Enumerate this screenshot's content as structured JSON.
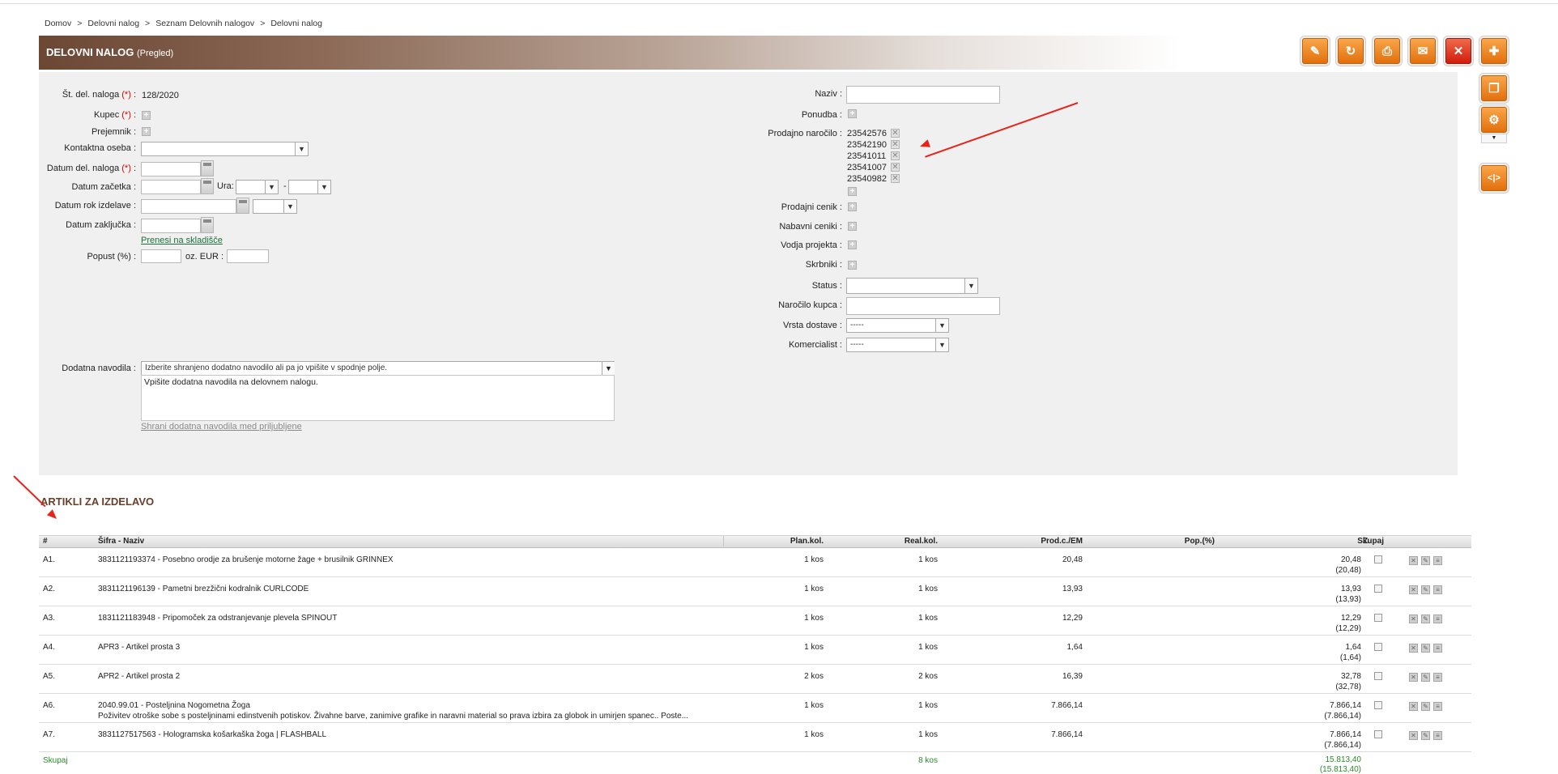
{
  "breadcrumb": [
    "Domov",
    "Delovni nalog",
    "Seznam Delovnih nalogov",
    "Delovni nalog"
  ],
  "breadcrumb_sep": ">",
  "header": {
    "title": "DELOVNI NALOG",
    "subtitle": "(Pregled)"
  },
  "toolbar": {
    "edit_icon": "pencil-icon",
    "refresh_icon": "refresh-icon",
    "print_icon": "printer-icon",
    "email_icon": "envelope-icon",
    "delete_icon": "close-icon",
    "add_icon": "plus-icon",
    "copy_icon": "copy-icon",
    "settings_icon": "gear-icon",
    "split_icon": "split-icon",
    "accent": "#f08a1c",
    "danger": "#d21c0b"
  },
  "form_left": {
    "st_label": "Št. del. naloga",
    "st_value": "128/2020",
    "kupec_label": "Kupec",
    "prejemnik_label": "Prejemnik",
    "kontakt_label": "Kontaktna oseba",
    "datum_del_label": "Datum del. naloga",
    "datum_zacetka_label": "Datum začetka",
    "ura_label": "Ura:",
    "dash": "-",
    "datum_rok_label": "Datum rok izdelave",
    "datum_zakljucka_label": "Datum zaključka",
    "prenesi_link": "Prenesi na skladišče",
    "popust_label": "Popust (%)",
    "oz_eur_label": "oz. EUR",
    "required_mark": "(*)",
    "colon": ":"
  },
  "form_right": {
    "naziv_label": "Naziv",
    "ponudba_label": "Ponudba",
    "prodajno_label": "Prodajno naročilo",
    "prodajna_narocila": [
      "23542576",
      "23542190",
      "23541011",
      "23541007",
      "23540982"
    ],
    "prodajni_cenik_label": "Prodajni cenik",
    "nabavni_ceniki_label": "Nabavni ceniki",
    "vodja_label": "Vodja projekta",
    "skrbniki_label": "Skrbniki",
    "status_label": "Status",
    "narocilo_kupca_label": "Naročilo kupca",
    "vrsta_dostave_label": "Vrsta dostave",
    "vrsta_dostave_value": "-----",
    "komercialist_label": "Komercialist",
    "komercialist_value": "-----"
  },
  "navodila": {
    "label": "Dodatna navodila",
    "select_placeholder": "Izberite shranjeno dodatno navodilo ali pa jo vpišite v spodnje polje.",
    "text": "Vpišite dodatna navodila na delovnem nalogu.",
    "save_link": "Shrani dodatna navodila med priljubljene"
  },
  "articles": {
    "title": "ARTIKLI ZA IZDELAVO",
    "columns": [
      "#",
      "Šifra - Naziv",
      "Plan.kol.",
      "Real.kol.",
      "Prod.c./EM",
      "Pop.(%)",
      "Skupaj",
      "Z."
    ],
    "rows": [
      {
        "num": "A1.",
        "name": "3831121193374 - Posebno orodje za brušenje motorne žage + brusilnik GRINNEX",
        "desc": "",
        "plan": "1 kos",
        "real": "1 kos",
        "price": "20,48",
        "total": "20,48",
        "total2": "(20,48)"
      },
      {
        "num": "A2.",
        "name": "3831121196139 - Pametni brezžični kodralnik CURLCODE",
        "desc": "",
        "plan": "1 kos",
        "real": "1 kos",
        "price": "13,93",
        "total": "13,93",
        "total2": "(13,93)"
      },
      {
        "num": "A3.",
        "name": "1831121183948 - Pripomoček za odstranjevanje plevela SPINOUT",
        "desc": "",
        "plan": "1 kos",
        "real": "1 kos",
        "price": "12,29",
        "total": "12,29",
        "total2": "(12,29)"
      },
      {
        "num": "A4.",
        "name": "APR3 - Artikel prosta 3",
        "desc": "",
        "plan": "1 kos",
        "real": "1 kos",
        "price": "1,64",
        "total": "1,64",
        "total2": "(1,64)"
      },
      {
        "num": "A5.",
        "name": "APR2 - Artikel prosta 2",
        "desc": "",
        "plan": "2 kos",
        "real": "2 kos",
        "price": "16,39",
        "total": "32,78",
        "total2": "(32,78)"
      },
      {
        "num": "A6.",
        "name": "2040.99.01 - Posteljnina Nogometna Žoga",
        "desc": "Poživitev otroške sobe s posteljninami edinstvenih potiskov. Živahne barve, zanimive grafike in naravni material so prava izbira za globok in umirjen spanec.. Poste...",
        "plan": "1 kos",
        "real": "1 kos",
        "price": "7.866,14",
        "total": "7.866,14",
        "total2": "(7.866,14)"
      },
      {
        "num": "A7.",
        "name": "3831127517563 - Hologramska košarkaška žoga | FLASHBALL",
        "desc": "",
        "plan": "1 kos",
        "real": "1 kos",
        "price": "7.866,14",
        "total": "7.866,14",
        "total2": "(7.866,14)"
      }
    ],
    "sum_label": "Skupaj",
    "sum_real": "8 kos",
    "sum_total": "15.813,40",
    "sum_total2": "(15.813,40)"
  }
}
